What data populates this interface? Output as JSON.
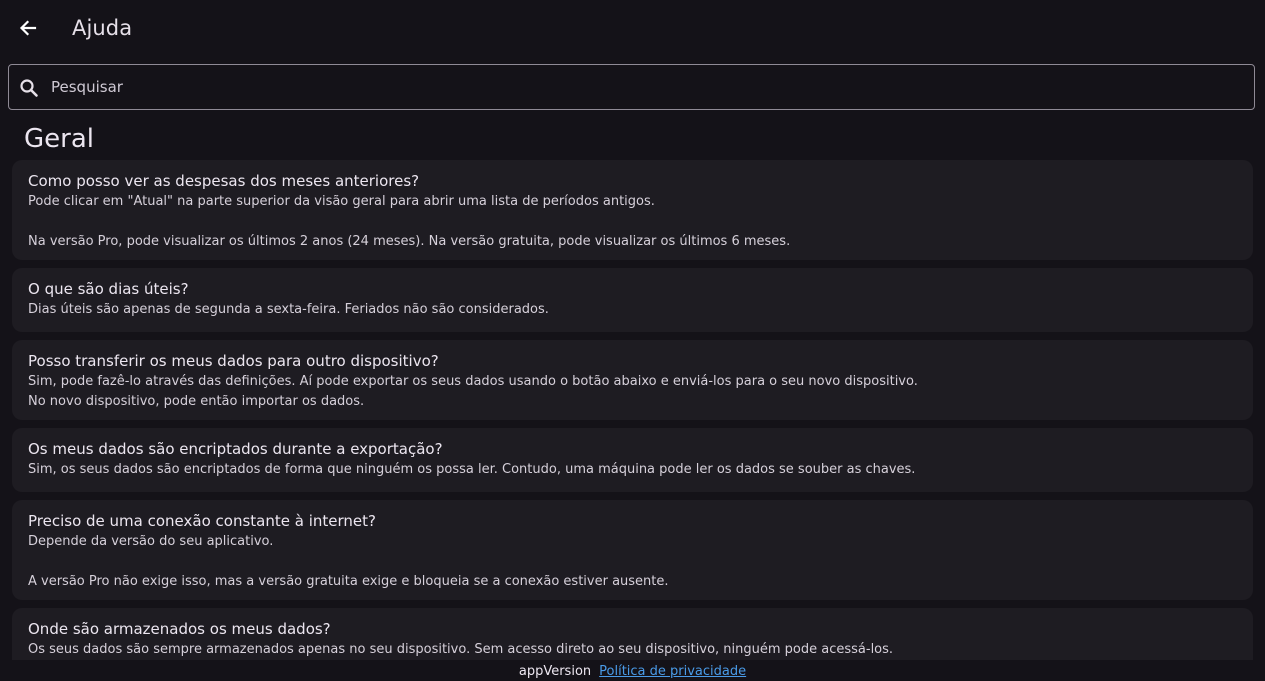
{
  "header": {
    "title": "Ajuda",
    "back_icon": "arrow-left-icon"
  },
  "search": {
    "placeholder": "Pesquisar",
    "value": "",
    "icon": "search-icon"
  },
  "section": {
    "title": "Geral"
  },
  "faq": [
    {
      "question": "Como posso ver as despesas dos meses anteriores?",
      "answer": "Pode clicar em \"Atual\" na parte superior da visão geral para abrir uma lista de períodos antigos.\n\nNa versão Pro, pode visualizar os últimos 2 anos (24 meses). Na versão gratuita, pode visualizar os últimos 6 meses."
    },
    {
      "question": "O que são dias úteis?",
      "answer": "Dias úteis são apenas de segunda a sexta-feira. Feriados não são considerados."
    },
    {
      "question": "Posso transferir os meus dados para outro dispositivo?",
      "answer": "Sim, pode fazê-lo através das definições. Aí pode exportar os seus dados usando o botão abaixo e enviá-los para o seu novo dispositivo.\nNo novo dispositivo, pode então importar os dados."
    },
    {
      "question": "Os meus dados são encriptados durante a exportação?",
      "answer": "Sim, os seus dados são encriptados de forma que ninguém os possa ler. Contudo, uma máquina pode ler os dados se souber as chaves."
    },
    {
      "question": "Preciso de uma conexão constante à internet?",
      "answer": "Depende da versão do seu aplicativo.\n\nA versão Pro não exige isso, mas a versão gratuita exige e bloqueia se a conexão estiver ausente."
    },
    {
      "question": "Onde são armazenados os meus dados?",
      "answer": "Os seus dados são sempre armazenados apenas no seu dispositivo. Sem acesso direto ao seu dispositivo, ninguém pode acessá-los."
    }
  ],
  "footer": {
    "version_label": "appVersion",
    "privacy_link": "Política de privacidade"
  },
  "colors": {
    "background": "#141218",
    "card": "#1e1c22",
    "text": "#e6e0e9",
    "link": "#4a9be8"
  }
}
